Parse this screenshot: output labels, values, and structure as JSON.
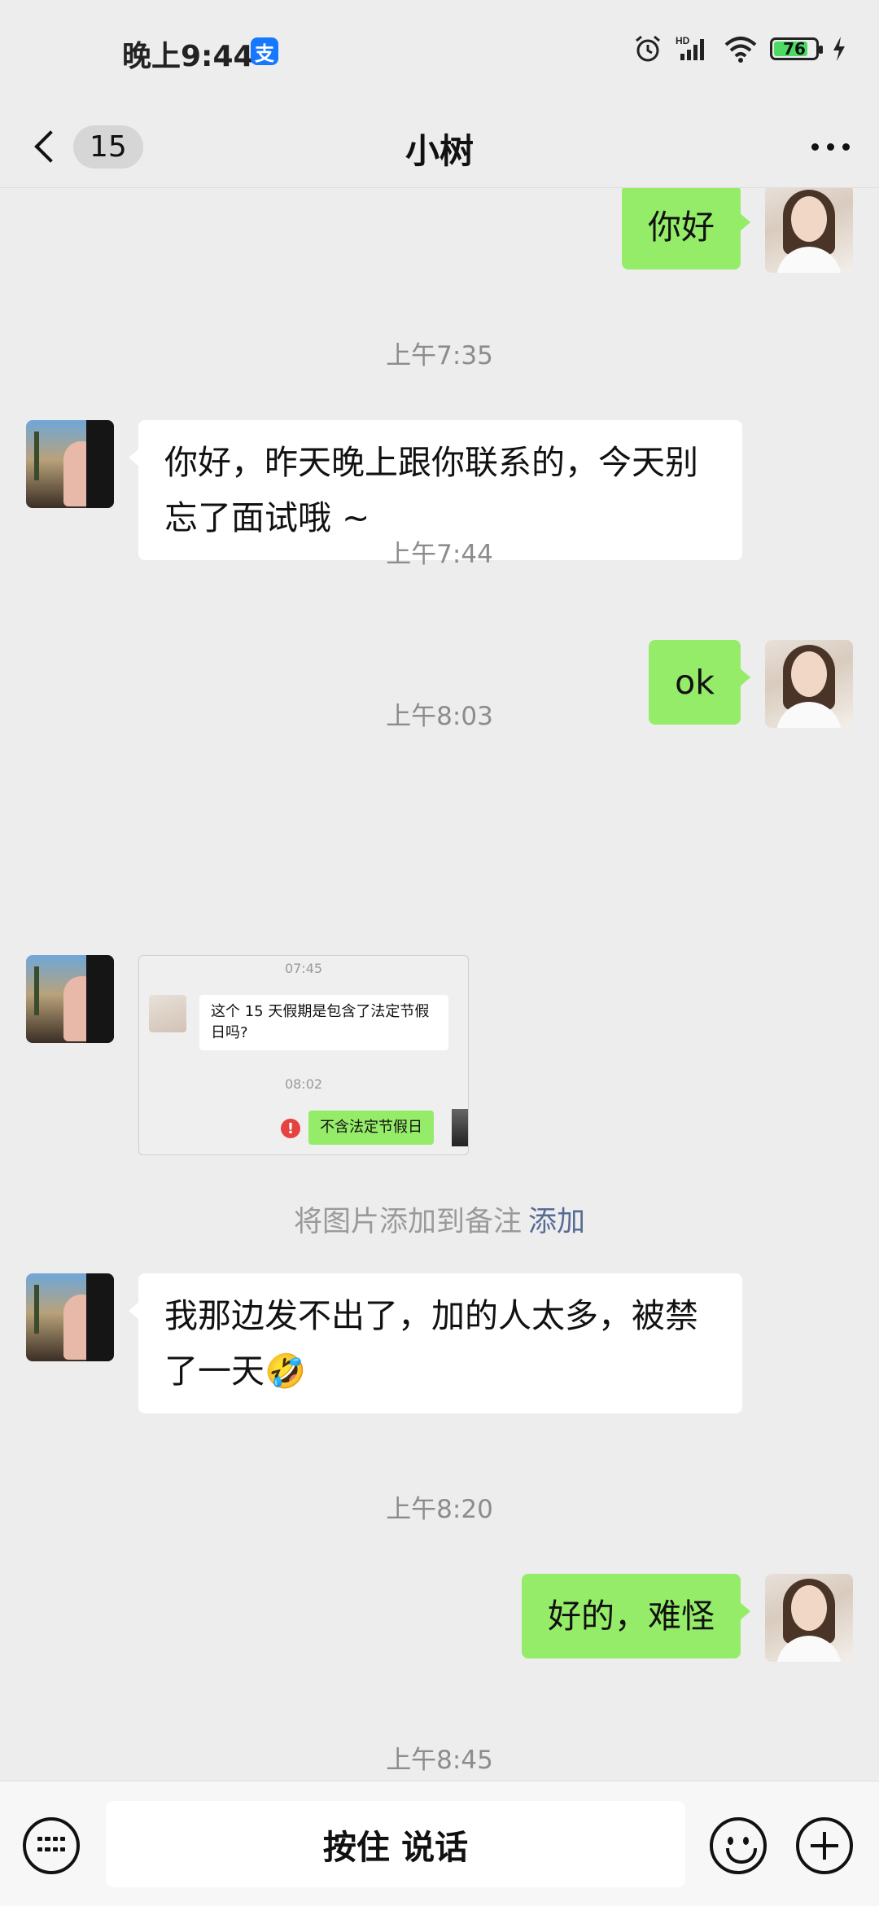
{
  "status": {
    "time": "晚上9:44",
    "app_icon": "alipay-icon",
    "alipay_glyph": "支",
    "battery": "76",
    "hd_label": "HD"
  },
  "header": {
    "unread": "15",
    "title": "小树"
  },
  "messages": [
    {
      "type": "text",
      "from": "me",
      "text": "你好"
    },
    {
      "type": "time",
      "text": "上午7:35"
    },
    {
      "type": "text",
      "from": "them",
      "text": "你好，昨天晚上跟你联系的，今天别忘了面试哦 ~"
    },
    {
      "type": "time",
      "text": "上午7:44"
    },
    {
      "type": "text",
      "from": "me",
      "text": "ok"
    },
    {
      "type": "time",
      "text": "上午8:03"
    },
    {
      "type": "image",
      "from": "them",
      "image": {
        "time1": "07:45",
        "question": "这个 15 天假期是包含了法定节假日吗?",
        "time2": "08:02",
        "reply": "不含法定节假日",
        "error_glyph": "!"
      }
    },
    {
      "type": "note",
      "text": "将图片添加到备注",
      "action": "添加"
    },
    {
      "type": "text",
      "from": "them",
      "text": "我那边发不出了，加的人太多，被禁了一天",
      "emoji": "🤣"
    },
    {
      "type": "time",
      "text": "上午8:20"
    },
    {
      "type": "text",
      "from": "me",
      "text": "好的，难怪"
    },
    {
      "type": "time",
      "text": "上午8:45"
    }
  ],
  "input": {
    "talk_label": "按住 说话"
  }
}
